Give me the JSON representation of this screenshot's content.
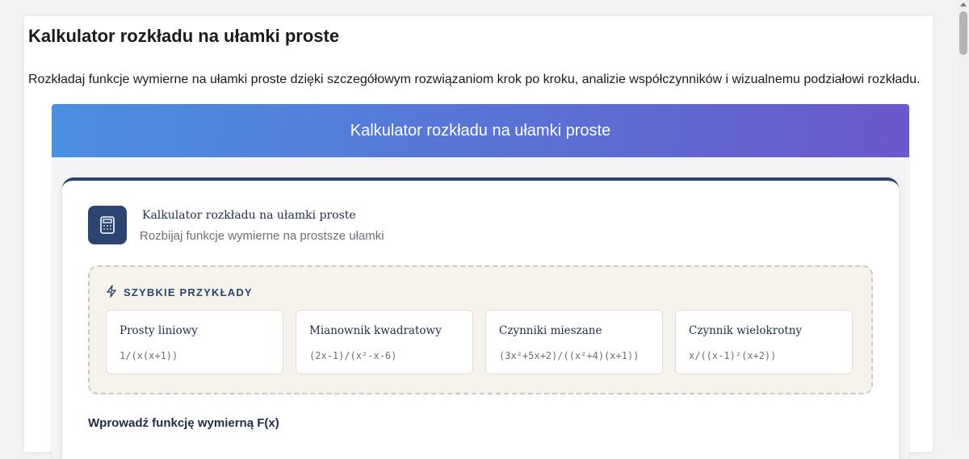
{
  "page": {
    "title": "Kalkulator rozkładu na ułamki proste",
    "description": "Rozkładaj funkcje wymierne na ułamki proste dzięki szczegółowym rozwiązaniom krok po kroku, analizie współczynników i wizualnemu podziałowi rozkładu."
  },
  "calculator": {
    "header_title": "Kalkulator rozkładu na ułamki proste",
    "tool_icon": "calculator-icon",
    "tool_title": "Kalkulator rozkładu na ułamki proste",
    "tool_subtitle": "Rozbijaj funkcje wymierne na prostsze ułamki",
    "quick_examples": {
      "heading": "SZYBKIE PRZYKŁADY",
      "icon": "lightning-icon",
      "items": [
        {
          "name": "Prosty liniowy",
          "expr": "1/(x(x+1))"
        },
        {
          "name": "Mianownik kwadratowy",
          "expr": "(2x-1)/(x²-x-6)"
        },
        {
          "name": "Czynniki mieszane",
          "expr": "(3x²+5x+2)/((x²+4)(x+1))"
        },
        {
          "name": "Czynnik wielokrotny",
          "expr": "x/((x-1)²(x+2))"
        }
      ]
    },
    "input_label": "Wprowadź funkcję wymierną F(x)"
  },
  "colors": {
    "header_gradient_start": "#4a90e2",
    "header_gradient_end": "#6a57cc",
    "navy": "#2b4470",
    "examples_bg": "#f6f3ec"
  }
}
